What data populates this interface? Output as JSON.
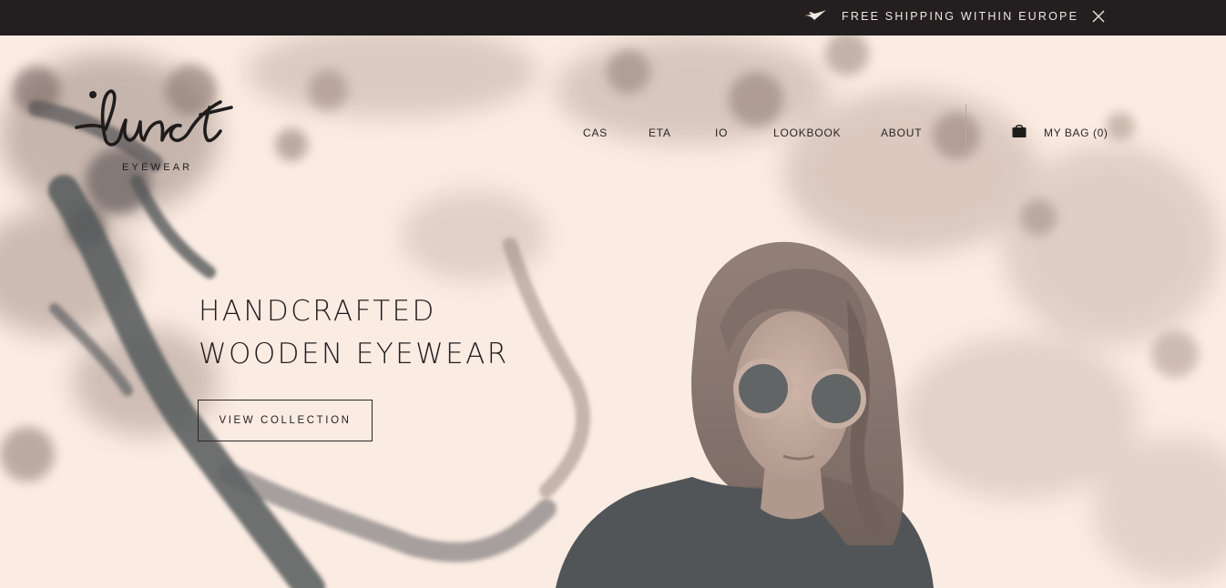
{
  "announcement": {
    "icon": "plane-icon",
    "text": "FREE SHIPPING WITHIN EUROPE",
    "close_icon": "close-icon"
  },
  "brand": {
    "logo_script": "lunet",
    "logo_subtitle": "EYEWEAR"
  },
  "nav": {
    "items": [
      {
        "label": "CAS"
      },
      {
        "label": "ETA"
      },
      {
        "label": "IO"
      },
      {
        "label": "LOOKBOOK"
      },
      {
        "label": "ABOUT"
      }
    ],
    "bag_icon": "shopping-bag-icon",
    "bag_label": "MY BAG (0)"
  },
  "hero": {
    "headline_line1": "HANDCRAFTED",
    "headline_line2": "WOODEN EYEWEAR",
    "cta_label": "VIEW COLLECTION",
    "image": "woman-wearing-wooden-sunglasses-under-tree"
  },
  "colors": {
    "topbar_bg": "#231f20",
    "page_bg": "#fbece3",
    "text": "#221e1e"
  }
}
